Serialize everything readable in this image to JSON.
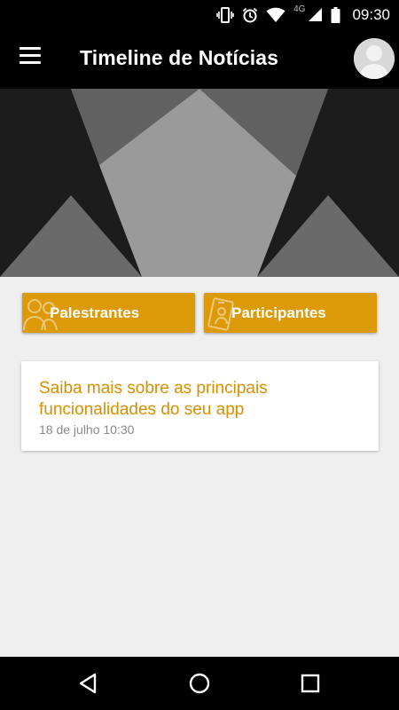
{
  "status_bar": {
    "time": "09:30",
    "network": "4G",
    "icons": [
      "vibrate-icon",
      "alarm-icon",
      "wifi-icon",
      "cell-signal-icon",
      "battery-icon"
    ]
  },
  "app_bar": {
    "title": "Timeline de Notícias",
    "menu_icon": "hamburger-menu-icon",
    "avatar_icon": "user-avatar-icon"
  },
  "shortcuts": [
    {
      "label": "Palestrantes",
      "icon": "speakers-icon"
    },
    {
      "label": "Participantes",
      "icon": "participant-badge-icon"
    }
  ],
  "news": [
    {
      "title": "Saiba mais sobre as principais funcionalidades do seu app",
      "date": "18 de julho 10:30"
    }
  ],
  "nav_bar": {
    "buttons": [
      "back-icon",
      "home-icon",
      "recents-icon"
    ]
  },
  "colors": {
    "accent": "#dd9a08",
    "news_title": "#d98f00",
    "background": "#efefef",
    "bars": "#000000"
  }
}
